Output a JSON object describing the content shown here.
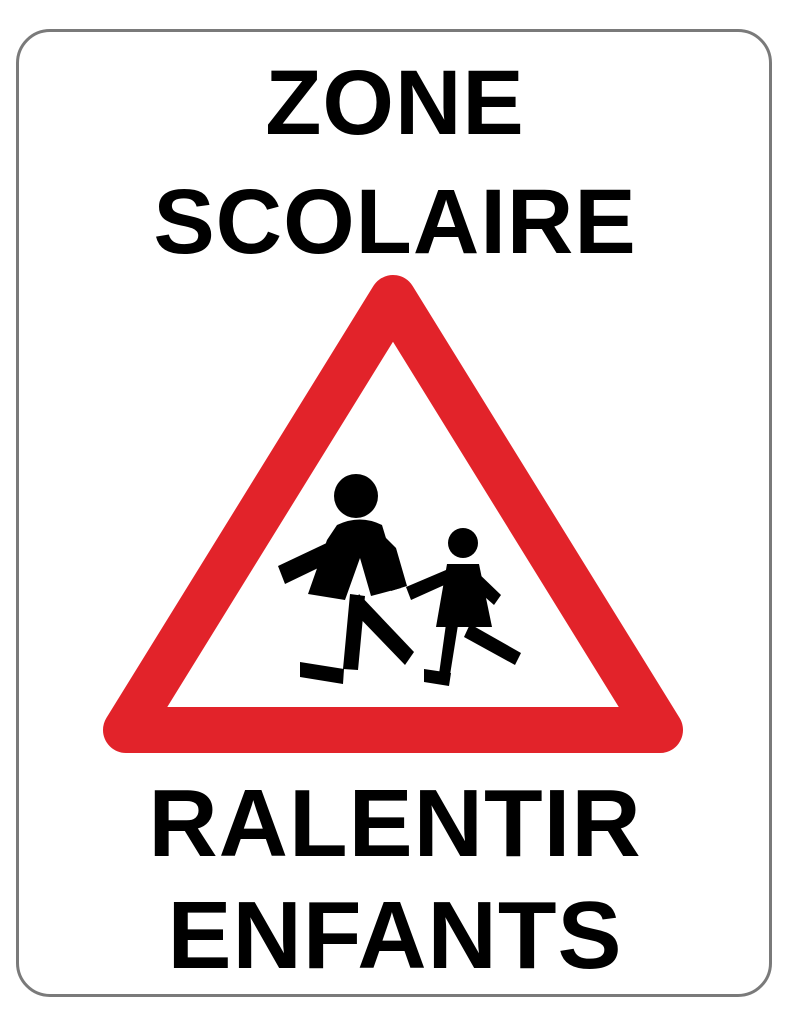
{
  "sign": {
    "top_text": [
      "ZONE",
      "SCOLAIRE"
    ],
    "bottom_text": [
      "RALENTIR",
      "ENFANTS"
    ],
    "pictogram": "children-crossing-icon",
    "colors": {
      "border": "#7a7a7a",
      "background": "#ffffff",
      "text": "#000000",
      "triangle": "#e2232a",
      "pictogram": "#000000"
    }
  }
}
